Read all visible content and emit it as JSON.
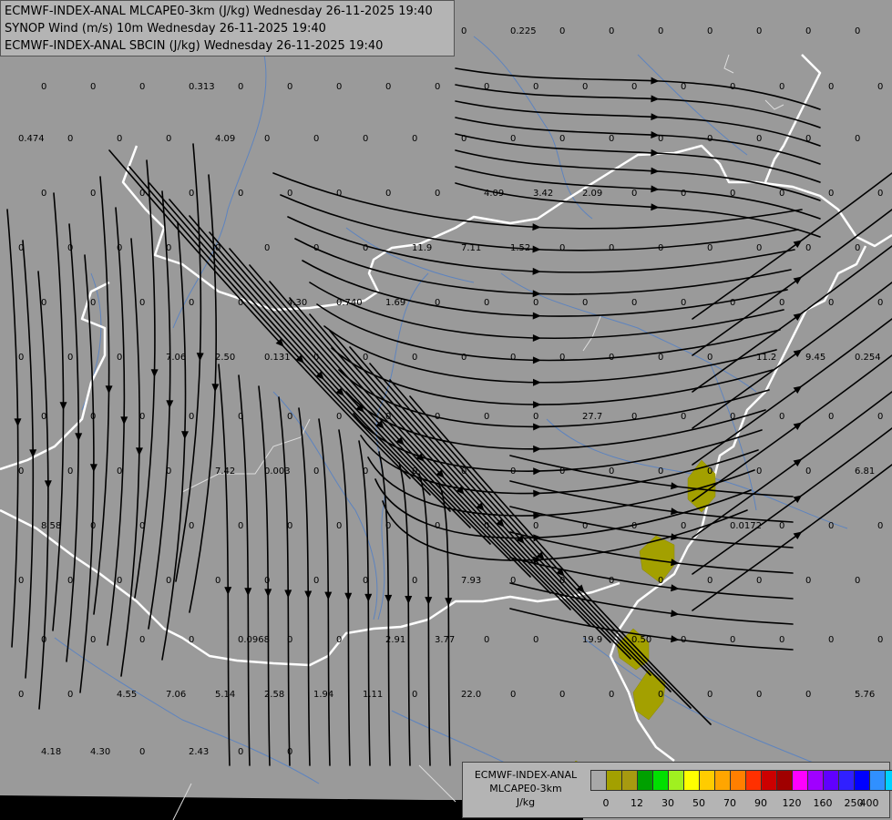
{
  "header": {
    "line1": "ECMWF-INDEX-ANAL MLCAPE0-3km (J/kg) Wednesday 26-11-2025 19:40",
    "line2": "SYNOP Wind (m/s) 10m Wednesday 26-11-2025 19:40",
    "line3": "ECMWF-INDEX-ANAL SBCIN (J/kg) Wednesday 26-11-2025 19:40"
  },
  "legend": {
    "title1": "ECMWF-INDEX-ANAL",
    "title2": "MLCAPE0-3km",
    "unit": "J/kg",
    "colors": [
      "#a8a8a8",
      "#a3a000",
      "#a79a10",
      "#00a000",
      "#00e000",
      "#a0f020",
      "#ffff00",
      "#ffcc00",
      "#ffa500",
      "#ff7f00",
      "#ff3000",
      "#cc0000",
      "#a00000",
      "#ff00ff",
      "#a000ff",
      "#6000ff",
      "#3020ff",
      "#0000ff",
      "#3090ff",
      "#00d0ff",
      "#80ffff",
      "#ffffff"
    ],
    "labels": [
      "0",
      "12",
      "30",
      "50",
      "70",
      "90",
      "120",
      "160",
      "250",
      "400"
    ]
  },
  "values": [
    "0",
    "0.225",
    "0",
    "0",
    "0",
    "0",
    "0",
    "0",
    "0",
    "0",
    "0",
    "0",
    "0.313",
    "0",
    "0",
    "0",
    "0",
    "0",
    "0",
    "0",
    "0",
    "0",
    "0",
    "0",
    "0",
    "0",
    "0",
    "0.474",
    "0",
    "0",
    "0",
    "4.09",
    "0",
    "0",
    "0",
    "0",
    "0",
    "0",
    "0",
    "0",
    "0",
    "0",
    "0",
    "0",
    "0",
    "0",
    "0",
    "0",
    "0",
    "0",
    "0",
    "0",
    "0",
    "0",
    "4.09",
    "3.42",
    "2.09",
    "0",
    "0",
    "0",
    "0",
    "0",
    "0",
    "0",
    "0",
    "0",
    "0",
    "0",
    "0",
    "0",
    "0",
    "11.9",
    "7.11",
    "1.52",
    "0",
    "0",
    "0",
    "0",
    "0",
    "0",
    "0",
    "0",
    "0",
    "0",
    "0",
    "0",
    "4.30",
    "0.740",
    "1.69",
    "0",
    "0",
    "0",
    "0",
    "0",
    "0",
    "0",
    "0",
    "0",
    "0",
    "0",
    "0",
    "0",
    "7.06",
    "2.50",
    "0.131",
    "0",
    "0",
    "0",
    "0",
    "0",
    "0",
    "0",
    "0",
    "0",
    "11.2",
    "9.45",
    "0.254",
    "0",
    "0",
    "0",
    "0",
    "0",
    "0",
    "0",
    "0",
    "0",
    "0",
    "0",
    "27.7",
    "0",
    "0",
    "0",
    "0",
    "0",
    "0",
    "0",
    "0",
    "0",
    "0",
    "7.42",
    "0.003",
    "0",
    "0",
    "0",
    "0",
    "0",
    "0",
    "0",
    "0",
    "0",
    "0",
    "0",
    "6.81",
    "8.58",
    "0",
    "0",
    "0",
    "0",
    "0",
    "0",
    "0",
    "0",
    "0",
    "0",
    "0",
    "0",
    "0",
    "0.0172",
    "0",
    "0",
    "0",
    "0",
    "0",
    "0",
    "0",
    "0",
    "0",
    "0",
    "0",
    "0",
    "7.93",
    "0",
    "0",
    "0",
    "0",
    "0",
    "0",
    "0",
    "0",
    "0",
    "0",
    "0",
    "0",
    "0.0968",
    "0",
    "0",
    "2.91",
    "3.77",
    "0",
    "0",
    "19.9",
    "0.50",
    "0",
    "0",
    "0",
    "0",
    "0",
    "0",
    "0",
    "4.55",
    "7.06",
    "5.14",
    "2.58",
    "1.94",
    "1.11",
    "0",
    "22.0",
    "0",
    "0",
    "0",
    "0",
    "0",
    "0",
    "0",
    "5.76",
    "4.18",
    "4.30",
    "0",
    "2.43",
    "0",
    "0"
  ]
}
